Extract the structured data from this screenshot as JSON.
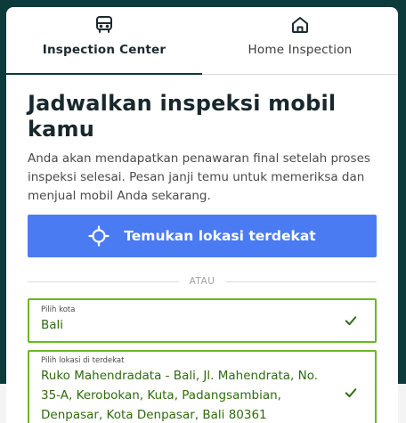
{
  "tabs": [
    {
      "label": "Inspection Center",
      "icon": "car-icon",
      "active": true
    },
    {
      "label": "Home Inspection",
      "icon": "home-icon",
      "active": false
    }
  ],
  "title": "Jadwalkan inspeksi mobil kamu",
  "description": "Anda akan mendapatkan penawaran final setelah proses inspeksi selesai. Pesan janji temu untuk memeriksa dan menjual mobil Anda sekarang.",
  "locate_button": {
    "label": "Temukan lokasi terdekat",
    "icon": "location-crosshair-icon"
  },
  "divider_text": "ATAU",
  "city_field": {
    "label": "Pilih kota",
    "value": "Bali"
  },
  "location_field": {
    "label": "Pilih lokasi di terdekat",
    "value": "Ruko Mahendradata - Bali, Jl. Mahendrata, No. 35-A, Kerobokan, Kuta, Padangsambian, Denpasar, Kota Denpasar, Bali 80361"
  },
  "colors": {
    "primary_button": "#4b7bf2",
    "valid_border": "#6bb524",
    "valid_text": "#2e6b0e",
    "background": "#0d3a3a"
  }
}
